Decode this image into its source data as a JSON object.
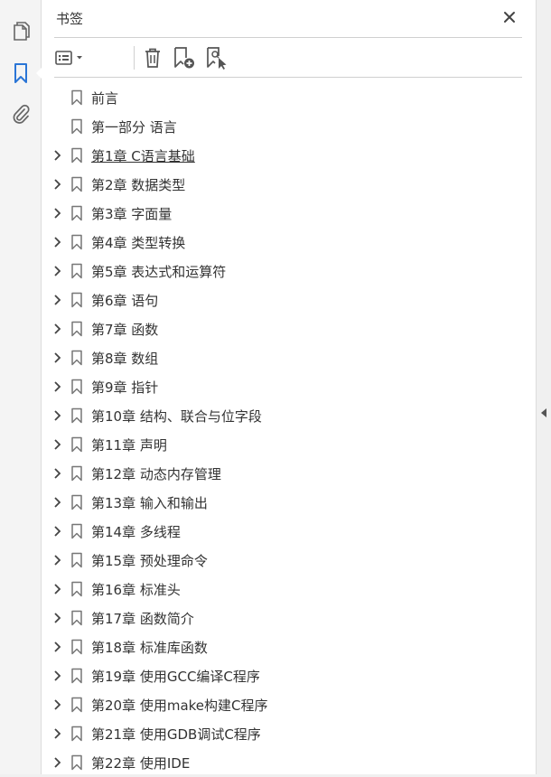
{
  "left_rail": {
    "items": [
      {
        "name": "pages-panel",
        "icon": "pages-icon"
      },
      {
        "name": "bookmarks-panel",
        "icon": "bookmark-panel-icon",
        "active": true
      },
      {
        "name": "attachments-panel",
        "icon": "paperclip-icon"
      }
    ]
  },
  "panel": {
    "title": "书签",
    "close_icon": "close-icon"
  },
  "toolbar": {
    "buttons": [
      {
        "name": "options-menu-button",
        "icon": "list-options-icon"
      },
      {
        "name": "delete-bookmark-button",
        "icon": "trash-icon"
      },
      {
        "name": "new-bookmark-button",
        "icon": "bookmark-add-icon"
      },
      {
        "name": "find-current-bookmark-button",
        "icon": "bookmark-find-icon"
      }
    ]
  },
  "bookmarks": [
    {
      "label": "前言",
      "expandable": false
    },
    {
      "label": "第一部分  语言",
      "expandable": false
    },
    {
      "label": "第1章  C语言基础",
      "expandable": true,
      "hover": true
    },
    {
      "label": "第2章  数据类型",
      "expandable": true
    },
    {
      "label": "第3章  字面量",
      "expandable": true
    },
    {
      "label": "第4章  类型转换",
      "expandable": true
    },
    {
      "label": "第5章  表达式和运算符",
      "expandable": true
    },
    {
      "label": "第6章  语句",
      "expandable": true
    },
    {
      "label": "第7章  函数",
      "expandable": true
    },
    {
      "label": "第8章  数组",
      "expandable": true
    },
    {
      "label": "第9章  指针",
      "expandable": true
    },
    {
      "label": "第10章  结构、联合与位字段",
      "expandable": true
    },
    {
      "label": "第11章  声明",
      "expandable": true
    },
    {
      "label": "第12章  动态内存管理",
      "expandable": true
    },
    {
      "label": "第13章  输入和输出",
      "expandable": true
    },
    {
      "label": "第14章  多线程",
      "expandable": true
    },
    {
      "label": "第15章  预处理命令",
      "expandable": true
    },
    {
      "label": "第16章  标准头",
      "expandable": true
    },
    {
      "label": "第17章  函数简介",
      "expandable": true
    },
    {
      "label": "第18章  标准库函数",
      "expandable": true
    },
    {
      "label": "第19章  使用GCC编译C程序",
      "expandable": true
    },
    {
      "label": "第20章  使用make构建C程序",
      "expandable": true
    },
    {
      "label": "第21章  使用GDB调试C程序",
      "expandable": true
    },
    {
      "label": "第22章  使用IDE",
      "expandable": true
    }
  ],
  "colors": {
    "accent": "#2a75d6",
    "icon": "#666666",
    "text": "#333333"
  },
  "right_strip": {
    "collapse_icon": "collapse-arrow-icon"
  }
}
